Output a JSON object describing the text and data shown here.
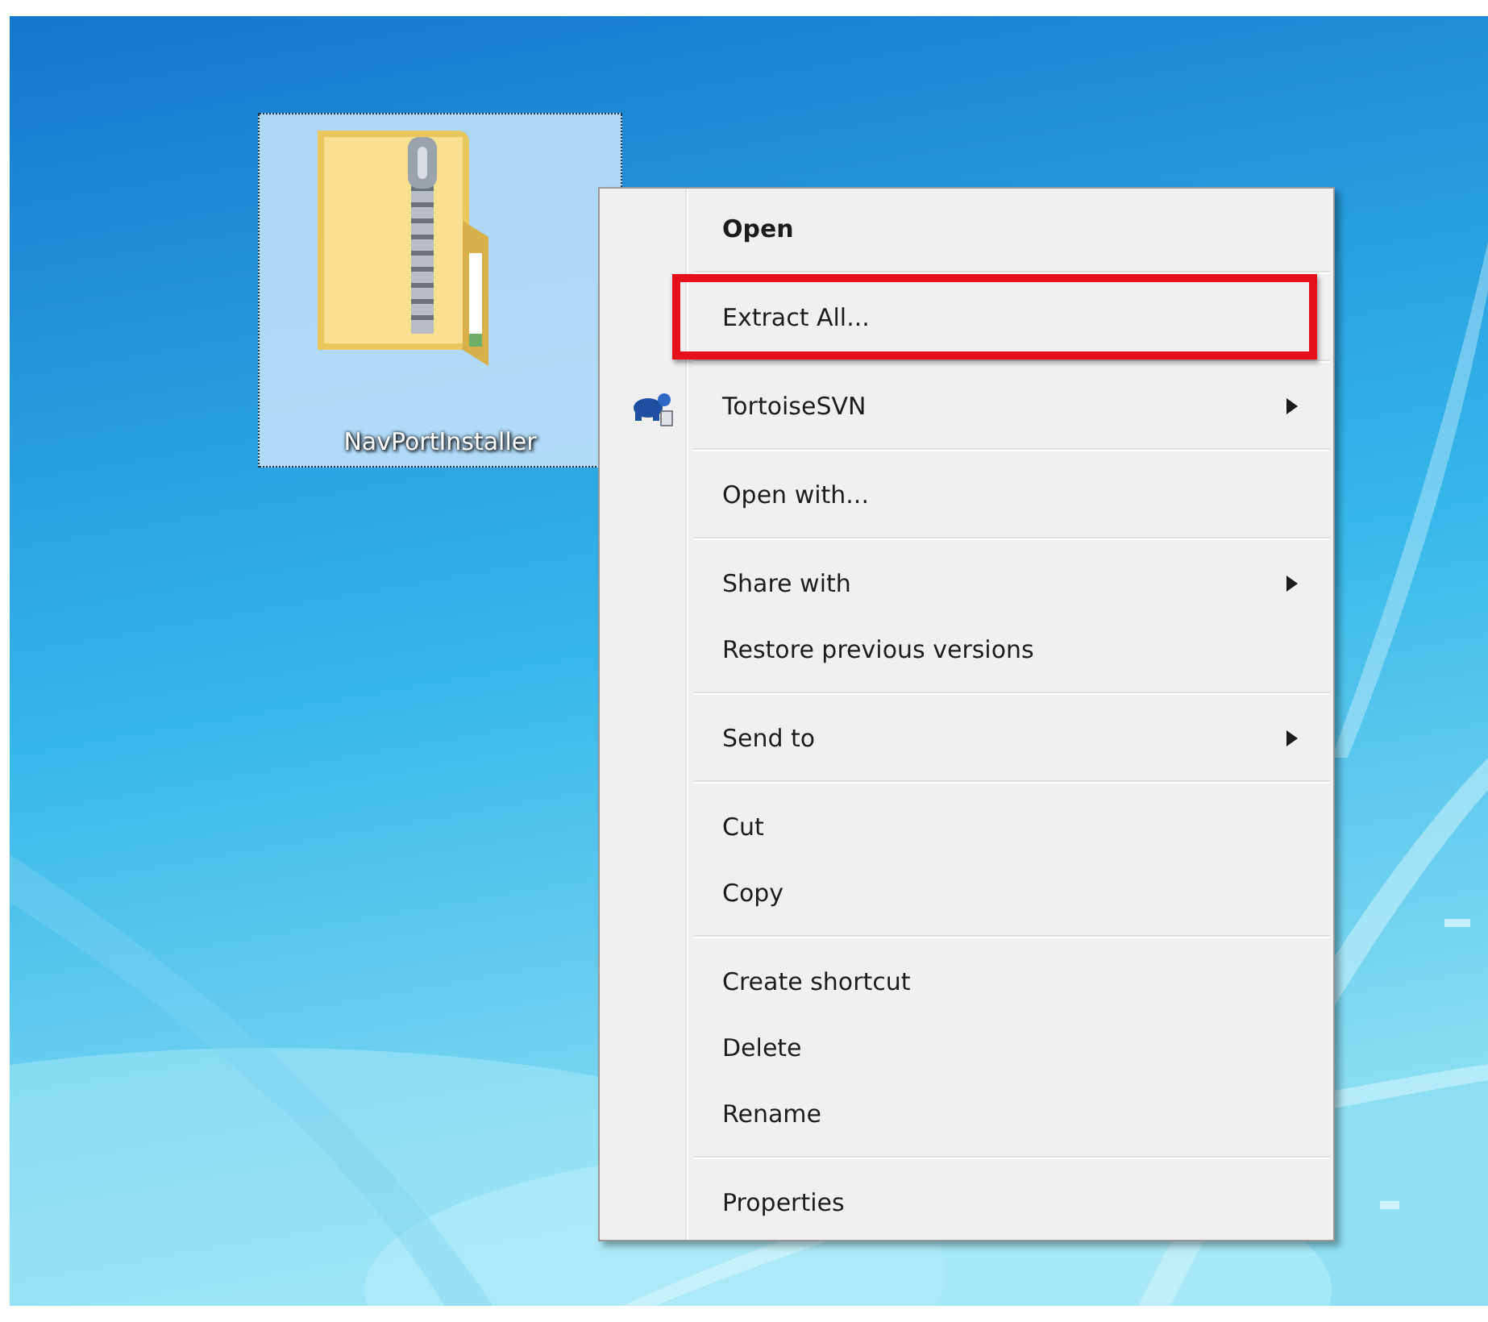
{
  "desktop_icon": {
    "label": "NavPortInstaller",
    "selected": true
  },
  "context_menu": {
    "groups": [
      [
        {
          "label": "Open",
          "default": true,
          "highlighted": false,
          "submenu": false,
          "has_icon": false
        }
      ],
      [
        {
          "label": "Extract All...",
          "default": false,
          "highlighted": true,
          "submenu": false,
          "has_icon": false
        }
      ],
      [
        {
          "label": "TortoiseSVN",
          "default": false,
          "highlighted": false,
          "submenu": true,
          "has_icon": true
        }
      ],
      [
        {
          "label": "Open with...",
          "default": false,
          "highlighted": false,
          "submenu": false,
          "has_icon": false
        }
      ],
      [
        {
          "label": "Share with",
          "default": false,
          "highlighted": false,
          "submenu": true,
          "has_icon": false
        },
        {
          "label": "Restore previous versions",
          "default": false,
          "highlighted": false,
          "submenu": false,
          "has_icon": false
        }
      ],
      [
        {
          "label": "Send to",
          "default": false,
          "highlighted": false,
          "submenu": true,
          "has_icon": false
        }
      ],
      [
        {
          "label": "Cut",
          "default": false,
          "highlighted": false,
          "submenu": false,
          "has_icon": false
        },
        {
          "label": "Copy",
          "default": false,
          "highlighted": false,
          "submenu": false,
          "has_icon": false
        }
      ],
      [
        {
          "label": "Create shortcut",
          "default": false,
          "highlighted": false,
          "submenu": false,
          "has_icon": false
        },
        {
          "label": "Delete",
          "default": false,
          "highlighted": false,
          "submenu": false,
          "has_icon": false
        },
        {
          "label": "Rename",
          "default": false,
          "highlighted": false,
          "submenu": false,
          "has_icon": false
        }
      ],
      [
        {
          "label": "Properties",
          "default": false,
          "highlighted": false,
          "submenu": false,
          "has_icon": false
        }
      ]
    ]
  }
}
